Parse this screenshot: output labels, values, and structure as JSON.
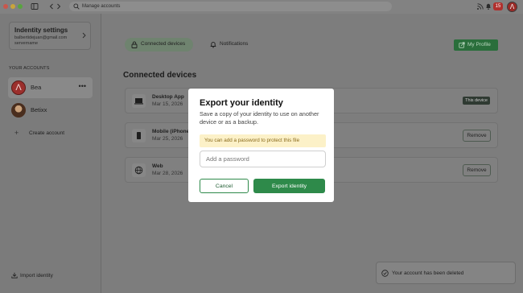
{
  "titlebar": {
    "search_placeholder": "Manage accounts",
    "notification_count": "15",
    "avatar_glyph": "Λ"
  },
  "sidebar": {
    "identity_card": {
      "title": "Indentity settings",
      "email": "balbertidejuan@gmail.com",
      "server": "servername"
    },
    "accounts_label": "YOUR ACCOUNTS",
    "accounts": [
      {
        "name": "Bea",
        "avatar_glyph": "Λ",
        "active": true,
        "more": "•••"
      },
      {
        "name": "Betixx",
        "active": false
      }
    ],
    "create_account_label": "Create account",
    "create_account_icon": "+",
    "import_identity_label": "Import identity"
  },
  "main": {
    "tabs": [
      {
        "label": "Connected devices",
        "icon": "lock-icon",
        "active": true
      },
      {
        "label": "Notifications",
        "icon": "bell-icon",
        "active": false
      }
    ],
    "profile_button_label": "My Profile",
    "section_title": "Connected devices",
    "devices": [
      {
        "name": "Desktop App",
        "date": "Mar 15, 2026",
        "icon": "laptop-icon",
        "badge": "This device"
      },
      {
        "name": "Mobile (iPhone",
        "date": "Mar 25, 2026",
        "icon": "phone-icon",
        "action": "Remove"
      },
      {
        "name": "Web",
        "date": "Mar 28, 2026",
        "icon": "globe-icon",
        "action": "Remove"
      }
    ]
  },
  "toast": {
    "message": "Your account has been deleted"
  },
  "modal": {
    "title": "Export your identity",
    "description": "Save a copy of your identity to use on another device or as a backup.",
    "hint": "You can add a password to protect this file",
    "password_placeholder": "Add a password",
    "password_value": "",
    "cancel_label": "Cancel",
    "export_label": "Export identity"
  },
  "colors": {
    "accent": "#2e8a4a",
    "hint_bg": "#fcf1c8",
    "badge_red": "#b0302d"
  }
}
